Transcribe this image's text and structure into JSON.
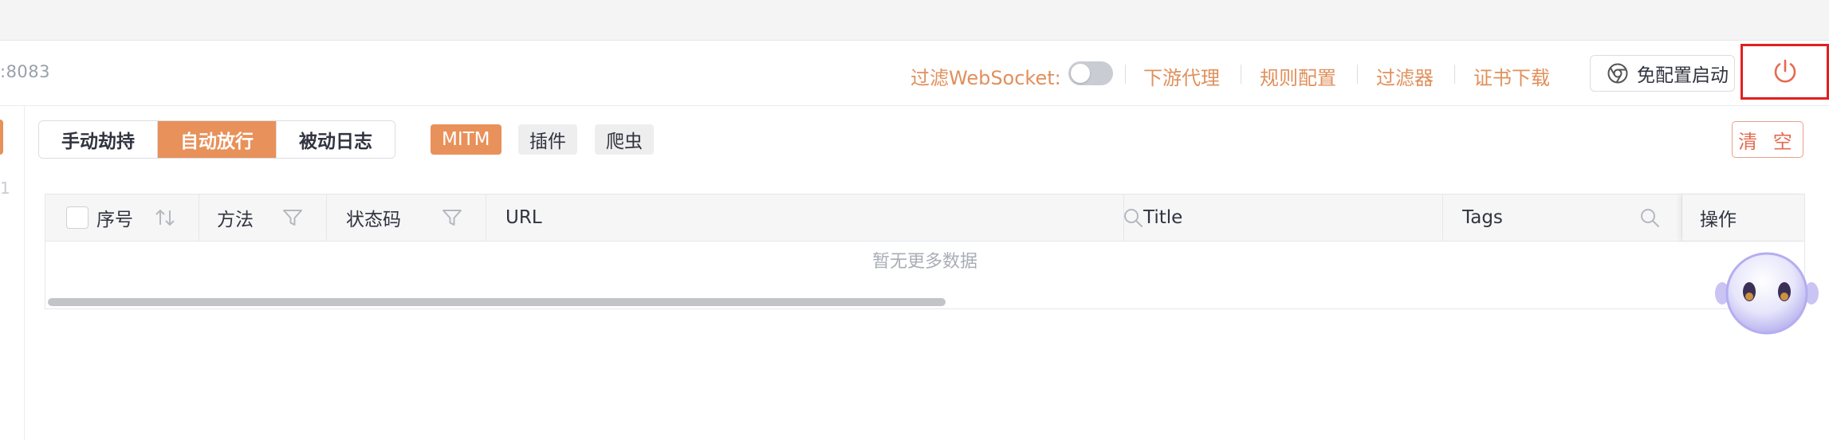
{
  "header": {
    "address_fragment": ":8083",
    "filter_websocket_label": "过滤WebSocket:",
    "links": [
      "下游代理",
      "规则配置",
      "过滤器",
      "证书下载"
    ],
    "chrome_button_label": "免配置启动",
    "power_icon": "power-icon"
  },
  "left_panel": {
    "digit": "1"
  },
  "toolbar": {
    "modes": [
      {
        "label": "手动劫持",
        "active": false
      },
      {
        "label": "自动放行",
        "active": true
      },
      {
        "label": "被动日志",
        "active": false
      }
    ],
    "tags": [
      "MITM",
      "插件",
      "爬虫"
    ],
    "clear_label": "清 空"
  },
  "table": {
    "columns": [
      "序号",
      "方法",
      "状态码",
      "URL",
      "Title",
      "Tags",
      "操作"
    ],
    "empty_text": "暂无更多数据"
  },
  "colors": {
    "accent": "#e8915a",
    "link": "#e0905c",
    "danger_border": "#e02020"
  }
}
